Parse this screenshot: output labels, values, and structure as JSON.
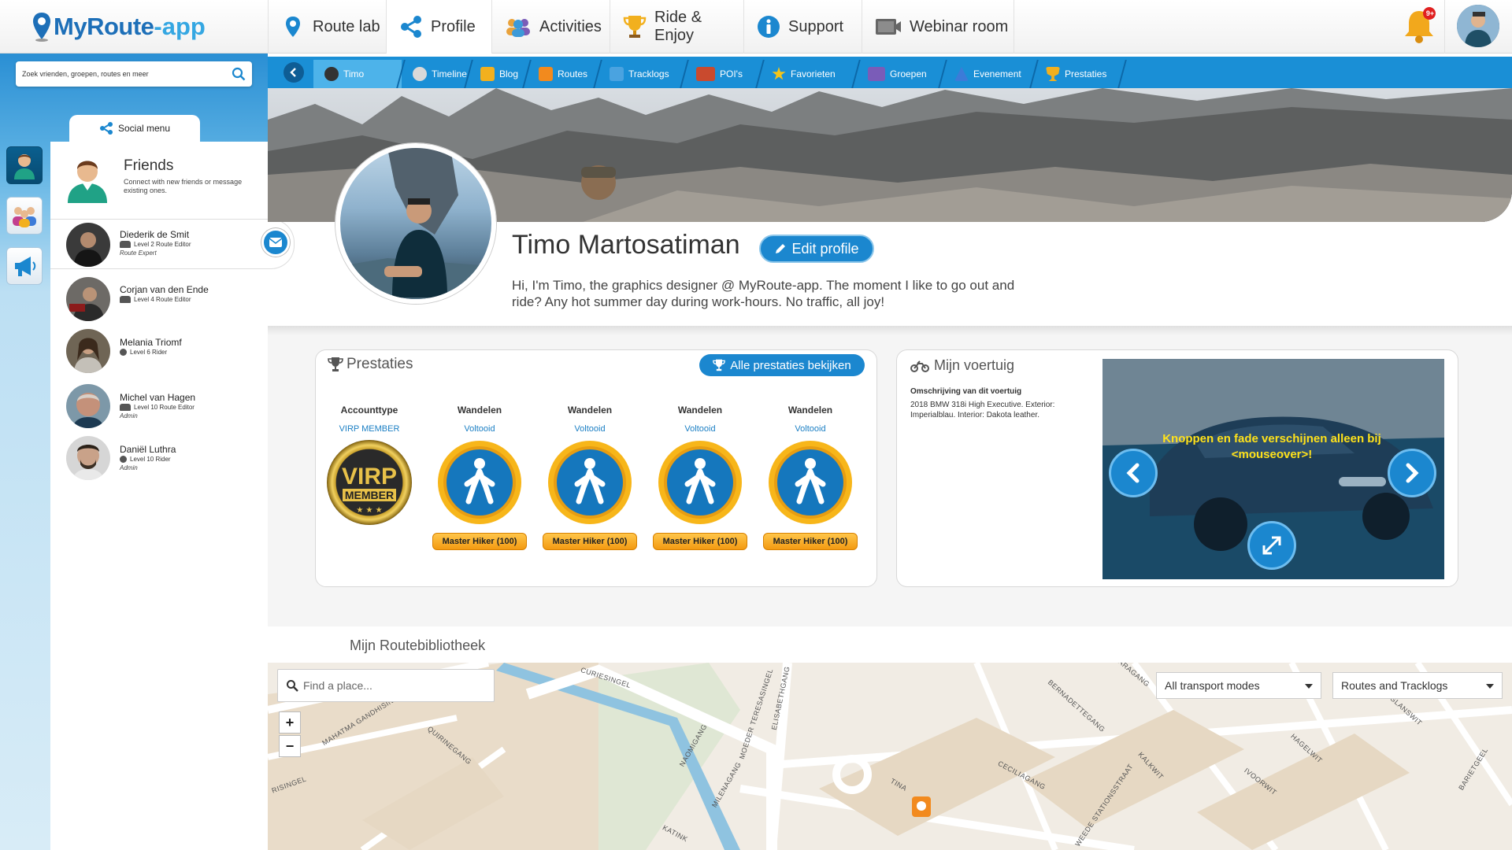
{
  "app": {
    "logo_text": "MyRoute",
    "logo_suffix": "-app"
  },
  "topnav": {
    "items": [
      {
        "label": "Route lab",
        "icon": "map-pin-icon"
      },
      {
        "label": "Profile",
        "icon": "share-icon"
      },
      {
        "label": "Activities",
        "icon": "people-icon"
      },
      {
        "label": "Ride & Enjoy",
        "icon": "trophy-icon"
      },
      {
        "label": "Support",
        "icon": "info-icon"
      },
      {
        "label": "Webinar room",
        "icon": "video-camera-icon"
      }
    ],
    "active": "Profile",
    "notification_badge": "9+"
  },
  "search": {
    "placeholder": "Zoek vrienden, groepen, routes en meer"
  },
  "social": {
    "tab_label": "Social menu",
    "friends_title": "Friends",
    "friends_subtitle": "Connect with new friends or message existing ones.",
    "friends": [
      {
        "name": "Diederik de Smit",
        "level": "Level 2 Route Editor",
        "role": "Route Expert"
      },
      {
        "name": "Corjan van den Ende",
        "level": "Level 4 Route Editor",
        "role": ""
      },
      {
        "name": "Melania Triomf",
        "level": "Level 6 Rider",
        "role": ""
      },
      {
        "name": "Michel van Hagen",
        "level": "Level 10 Route Editor",
        "role": "Admin"
      },
      {
        "name": "Daniël Luthra",
        "level": "Level 10 Rider",
        "role": "Admin"
      }
    ]
  },
  "subnav": {
    "tabs": [
      {
        "label": "Timo",
        "icon": "globe-icon"
      },
      {
        "label": "Timeline",
        "icon": "clock-icon"
      },
      {
        "label": "Blog",
        "icon": "pen-icon"
      },
      {
        "label": "Routes",
        "icon": "route-icon"
      },
      {
        "label": "Tracklogs",
        "icon": "footprints-icon"
      },
      {
        "label": "POI's",
        "icon": "poi-icon"
      },
      {
        "label": "Favorieten",
        "icon": "star-icon"
      },
      {
        "label": "Groepen",
        "icon": "group-icon"
      },
      {
        "label": "Evenement",
        "icon": "event-icon"
      },
      {
        "label": "Prestaties",
        "icon": "trophy-icon"
      }
    ],
    "active": "Timo"
  },
  "profile": {
    "name": "Timo Martosatiman",
    "edit_label": "Edit profile",
    "bio": "Hi, I'm Timo, the graphics designer @ MyRoute-app. The moment I like to go out and ride? Any hot summer day during work-hours. No traffic, all joy!"
  },
  "prestaties": {
    "title": "Prestaties",
    "all_button": "Alle prestaties bekijken",
    "badges": [
      {
        "category": "Accounttype",
        "status": "VIRP MEMBER",
        "medal": "VIRP MEMBER",
        "medal_line1": "VIRP",
        "medal_line2": "MEMBER",
        "label": ""
      },
      {
        "category": "Wandelen",
        "status": "Voltooid",
        "medal": "hiker",
        "label": "Master Hiker (100)"
      },
      {
        "category": "Wandelen",
        "status": "Voltooid",
        "medal": "hiker",
        "label": "Master Hiker (100)"
      },
      {
        "category": "Wandelen",
        "status": "Voltooid",
        "medal": "hiker",
        "label": "Master Hiker (100)"
      },
      {
        "category": "Wandelen",
        "status": "Voltooid",
        "medal": "hiker",
        "label": "Master Hiker (100)"
      }
    ]
  },
  "vehicle": {
    "title": "Mijn voertuig",
    "desc_label": "Omschrijving van dit voertuig",
    "description": "2018 BMW 318i High Executive. Exterior: Imperialblau. Interior: Dakota leather.",
    "caption": "Knoppen en fade verschijnen alleen bij <mouseover>!"
  },
  "library": {
    "title": "Mijn Routebibliotheek",
    "place_placeholder": "Find a place...",
    "transport_select": "All transport modes",
    "type_select": "Routes and Tracklogs",
    "zoom_in": "+",
    "zoom_out": "−",
    "streets": [
      "CURIESINGEL",
      "MAHATMA GANDHISIN",
      "QUIRINEGANG",
      "NAOMIGANG",
      "MILENAGANG",
      "MOEDER TERESASINGEL",
      "ELISABETHGANG",
      "BERNADETTEGANG",
      "BARAGANG",
      "GLANSWIT",
      "HAGELWIT",
      "IVOORWIT",
      "KALKWIT",
      "CECILIAGANG",
      "TINA",
      "BARIETGEEL",
      "WEEDE STATIONSSTRAAT",
      "KATINK",
      "RISINGEL"
    ]
  },
  "colors": {
    "brand": "#1b87cf",
    "subnav": "#1a8fd6",
    "badge_pill": "#f39a12",
    "caption": "#ffe21a"
  }
}
